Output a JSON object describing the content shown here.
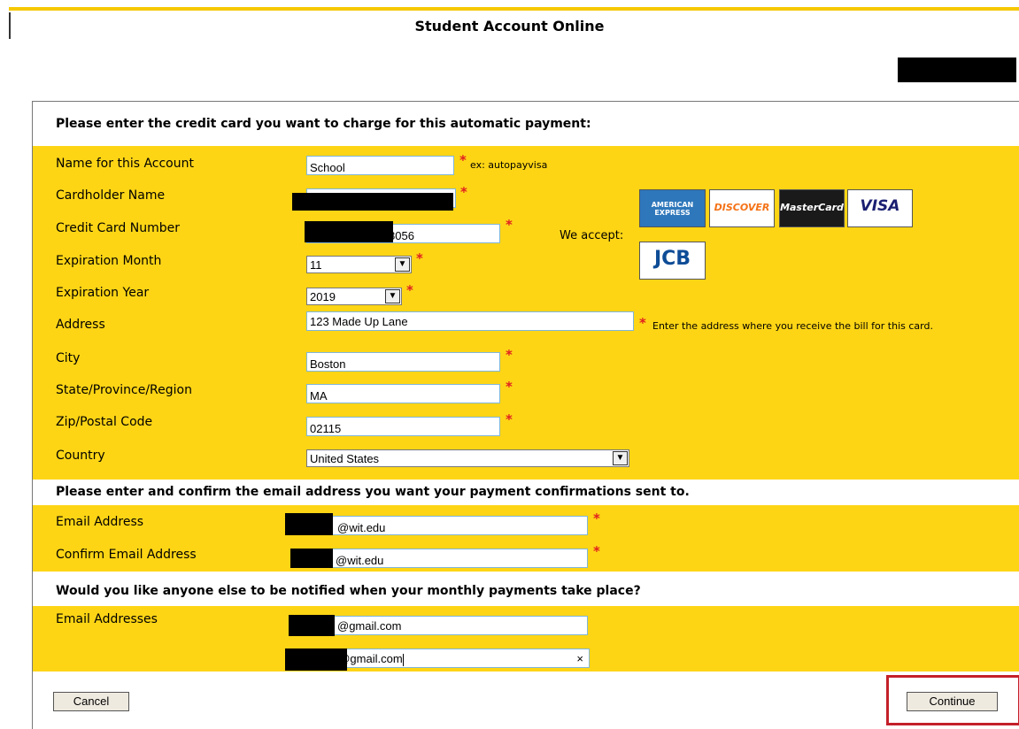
{
  "app": {
    "title": "Student Account Online"
  },
  "sections": {
    "card_heading": "Please enter the credit card you want to charge for this automatic payment:",
    "email_heading": "Please enter and confirm the email address you want your payment confirmations sent to.",
    "notify_heading": "Would you like anyone else to be notified when your monthly payments take place?"
  },
  "form": {
    "account_name": {
      "label": "Name for this Account",
      "value": "School",
      "hint": "ex: autopayvisa"
    },
    "cardholder": {
      "label": "Cardholder Name",
      "value": ""
    },
    "card_number": {
      "label": "Credit Card Number",
      "value": "8056"
    },
    "exp_month": {
      "label": "Expiration Month",
      "value": "11"
    },
    "exp_year": {
      "label": "Expiration Year",
      "value": "2019"
    },
    "address": {
      "label": "Address",
      "value": "123 Made Up Lane",
      "hint": "Enter the address where you receive the bill for this card."
    },
    "city": {
      "label": "City",
      "value": "Boston"
    },
    "state": {
      "label": "State/Province/Region",
      "value": "MA"
    },
    "zip": {
      "label": "Zip/Postal Code",
      "value": "02115"
    },
    "country": {
      "label": "Country",
      "value": "United States"
    },
    "email": {
      "label": "Email Address",
      "value": "@wit.edu"
    },
    "confirm_email": {
      "label": "Confirm Email Address",
      "value": "@wit.edu"
    },
    "notify_emails": {
      "label": "Email Addresses",
      "value1": "@gmail.com",
      "value2": "h@gmail.com"
    }
  },
  "accept": {
    "label": "We accept:",
    "cards": [
      {
        "name": "american-express",
        "text": "AMERICAN EXPRESS",
        "color": "#2e77bb"
      },
      {
        "name": "discover",
        "text": "DISCOVER",
        "color": "#f47216"
      },
      {
        "name": "mastercard",
        "text": "MasterCard",
        "color": "#eb001b"
      },
      {
        "name": "visa",
        "text": "VISA",
        "color": "#1a1f71"
      },
      {
        "name": "jcb",
        "text": "JCB",
        "color": "#0e4c96"
      }
    ]
  },
  "required_mark": "*",
  "buttons": {
    "cancel": "Cancel",
    "continue": "Continue"
  },
  "colors": {
    "band": "#fed515",
    "required": "#e02020",
    "highlight": "#c4202a"
  }
}
